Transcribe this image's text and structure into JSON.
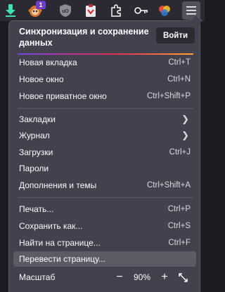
{
  "toolbar": {
    "extensions_badge": "1",
    "ublock_label": "uO"
  },
  "sync": {
    "title": "Синхронизация и сохранение данных",
    "signin_label": "Войти"
  },
  "menu": {
    "new_tab": {
      "label": "Новая вкладка",
      "shortcut": "Ctrl+T"
    },
    "new_window": {
      "label": "Новое окно",
      "shortcut": "Ctrl+N"
    },
    "new_private": {
      "label": "Новое приватное окно",
      "shortcut": "Ctrl+Shift+P"
    },
    "bookmarks": {
      "label": "Закладки"
    },
    "history": {
      "label": "Журнал"
    },
    "downloads": {
      "label": "Загрузки",
      "shortcut": "Ctrl+J"
    },
    "passwords": {
      "label": "Пароли"
    },
    "addons": {
      "label": "Дополнения и темы",
      "shortcut": "Ctrl+Shift+A"
    },
    "print": {
      "label": "Печать...",
      "shortcut": "Ctrl+P"
    },
    "save_as": {
      "label": "Сохранить как...",
      "shortcut": "Ctrl+S"
    },
    "find": {
      "label": "Найти на странице...",
      "shortcut": "Ctrl+F"
    },
    "translate": {
      "label": "Перевести страницу..."
    }
  },
  "zoom": {
    "label": "Масштаб",
    "value": "90%",
    "minus": "−",
    "plus": "+"
  },
  "colors": {
    "panel": "#42414d",
    "toolbar": "#2b2a33",
    "highlight": "#5b5b66",
    "accent_gradient": [
      "#7542e5",
      "#e02950",
      "#ffa436"
    ]
  }
}
